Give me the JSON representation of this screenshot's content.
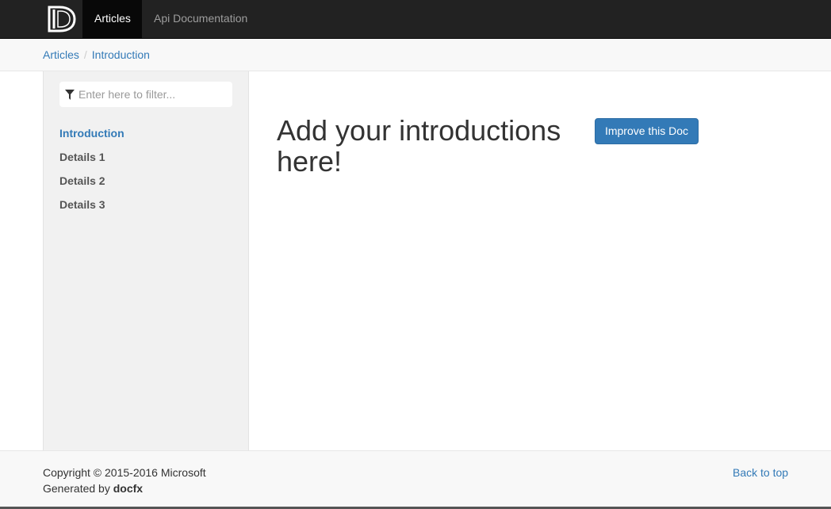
{
  "navbar": {
    "logo_icon": "docfx-logo-icon",
    "items": [
      {
        "label": "Articles",
        "active": true
      },
      {
        "label": "Api Documentation",
        "active": false
      }
    ]
  },
  "breadcrumb": [
    "Articles",
    "Introduction"
  ],
  "sidebar": {
    "filter_placeholder": "Enter here to filter...",
    "filter_icon": "filter-icon",
    "items": [
      {
        "label": "Introduction",
        "active": true
      },
      {
        "label": "Details 1",
        "active": false
      },
      {
        "label": "Details 2",
        "active": false
      },
      {
        "label": "Details 3",
        "active": false
      }
    ]
  },
  "article": {
    "title": "Add your introductions here!",
    "improve_button": "Improve this Doc"
  },
  "footer": {
    "copyright": "Copyright © 2015-2016 Microsoft",
    "generated_prefix": "Generated by ",
    "generator": "docfx",
    "back_to_top": "Back to top"
  },
  "colors": {
    "navbar_bg": "#222222",
    "link": "#337ab7",
    "button": "#337ab7",
    "sidebar_bg": "#f1f1f1"
  }
}
